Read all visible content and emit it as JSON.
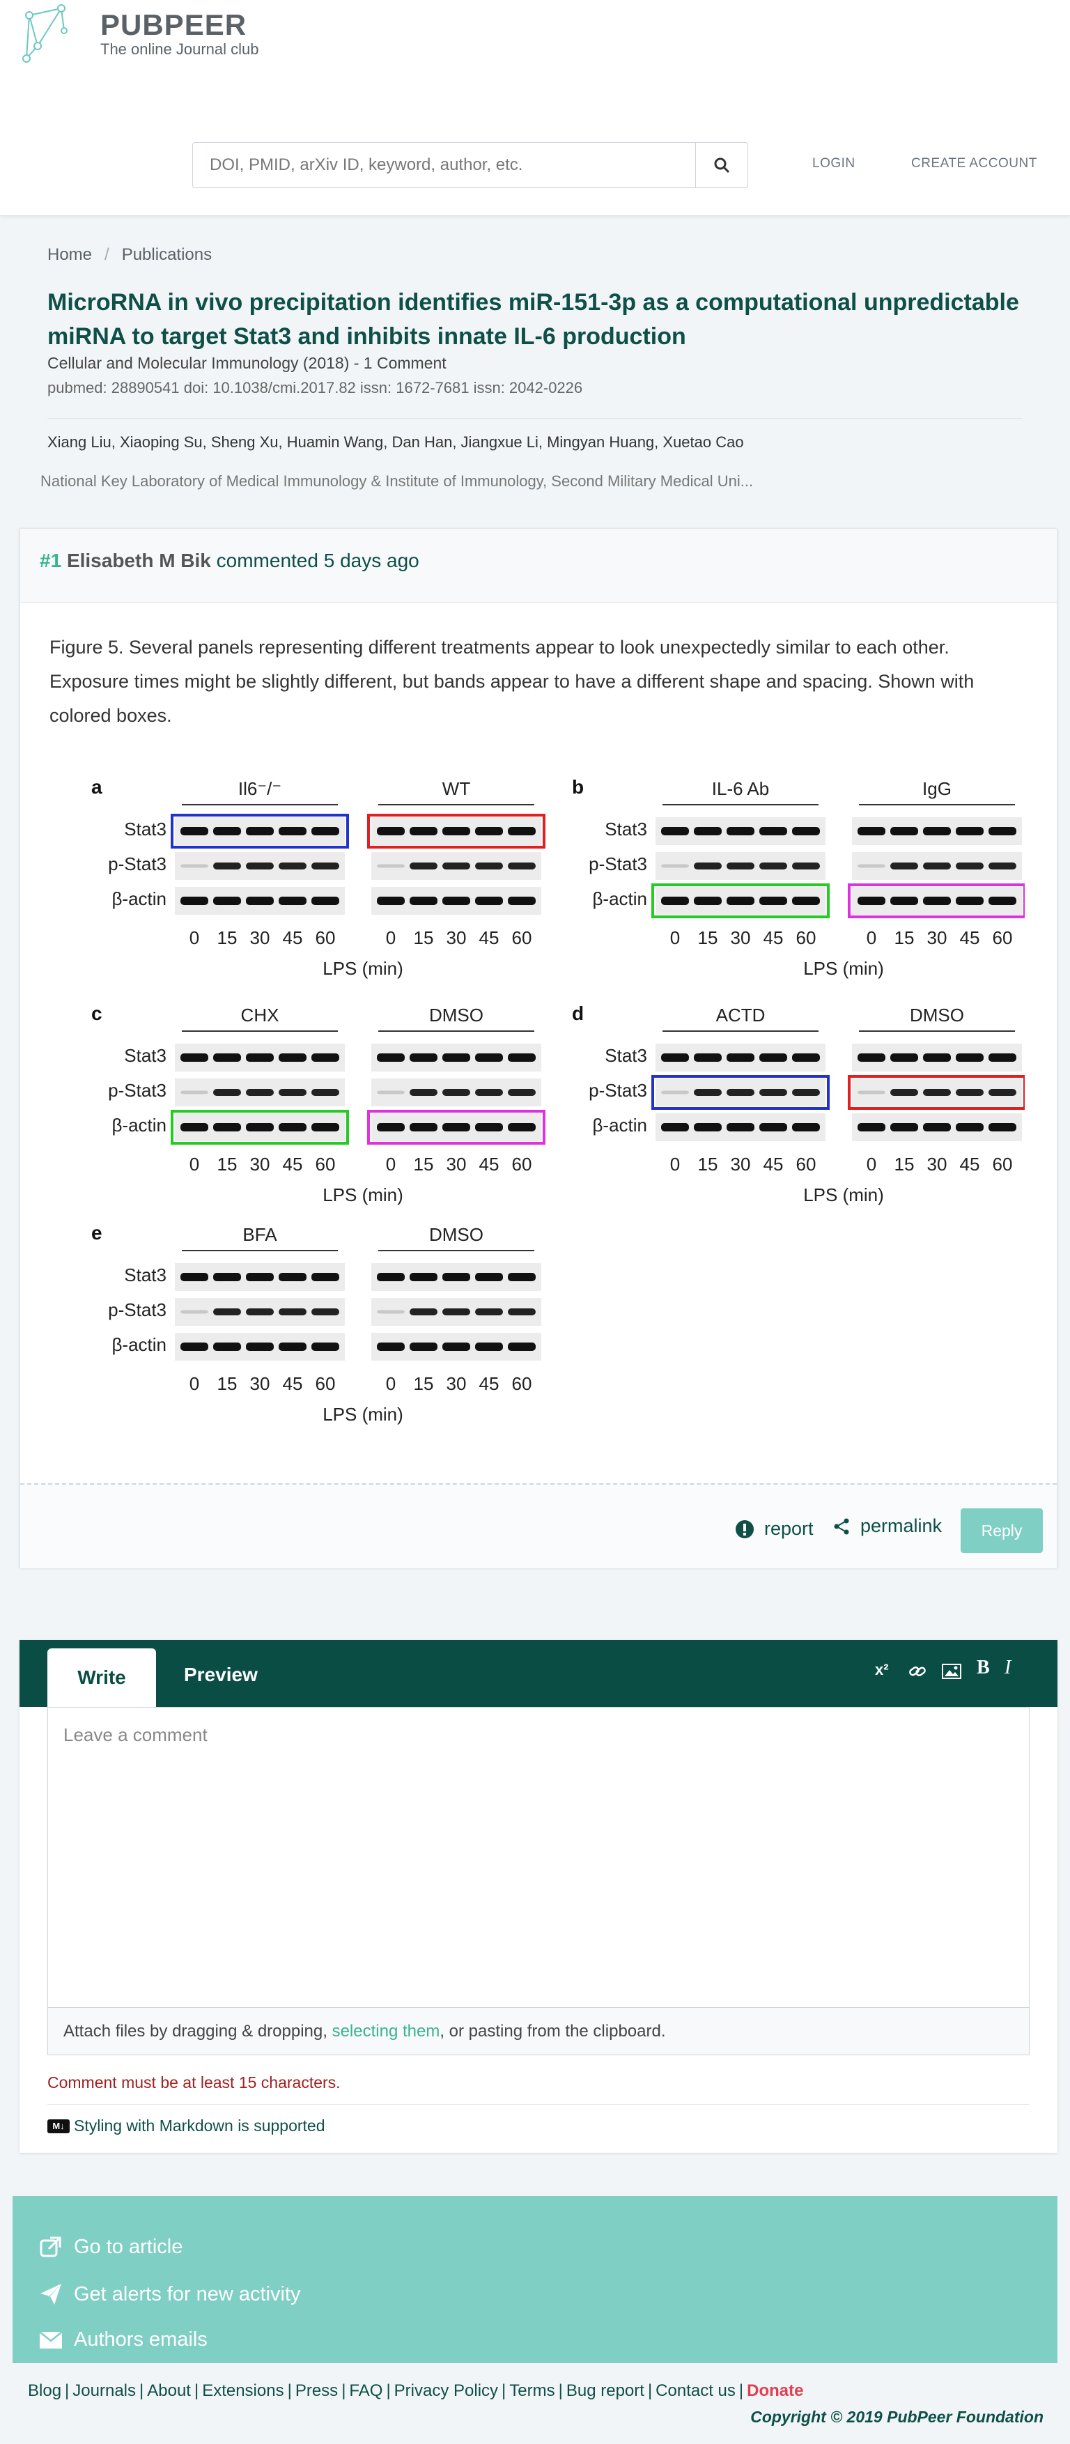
{
  "header": {
    "logo_text": "PUBPEER",
    "tagline": "The online Journal club",
    "search_placeholder": "DOI, PMID, arXiv ID, keyword, author, etc.",
    "login": "LOGIN",
    "create_account": "CREATE ACCOUNT"
  },
  "breadcrumb": [
    "Home",
    "Publications"
  ],
  "article": {
    "title": "MicroRNA in vivo precipitation identifies miR-151-3p as a computational unpredictable miRNA to target Stat3 and inhibits innate IL-6 production",
    "journal": "Cellular and Molecular Immunology (2018) - 1 Comment",
    "ids": "pubmed: 28890541  doi: 10.1038/cmi.2017.82  issn: 1672-7681  issn: 2042-0226",
    "authors": "Xiang Liu, Xiaoping Su, Sheng Xu, Huamin Wang, Dan Han, Jiangxue Li, Mingyan Huang, Xuetao Cao",
    "affiliation": "National Key Laboratory of Medical Immunology & Institute of Immunology, Second Military Medical Uni..."
  },
  "comment": {
    "number": "#1",
    "author": "Elisabeth M Bik",
    "when": "commented 5 days ago",
    "body": "Figure 5. Several panels representing different treatments appear to look unexpectedly similar to each other. Exposure times might be slightly different, but bands appear to have a different shape and spacing. Shown with colored boxes.",
    "report": "report",
    "permalink": "permalink",
    "reply": "Reply"
  },
  "figure": {
    "row_labels": [
      "Stat3",
      "p-Stat3",
      "β-actin"
    ],
    "timepoints": [
      "0",
      "15",
      "30",
      "45",
      "60"
    ],
    "axis_label": "LPS (min)",
    "panels": [
      {
        "letter": "a",
        "groups": [
          "Il6⁻/⁻",
          "WT"
        ]
      },
      {
        "letter": "b",
        "groups": [
          "IL-6 Ab",
          "IgG"
        ]
      },
      {
        "letter": "c",
        "groups": [
          "CHX",
          "DMSO"
        ]
      },
      {
        "letter": "d",
        "groups": [
          "ACTD",
          "DMSO"
        ]
      },
      {
        "letter": "e",
        "groups": [
          "BFA",
          "DMSO"
        ]
      }
    ],
    "box_colors": {
      "blue": "#2233cc",
      "red": "#e02020",
      "green": "#22cc22",
      "magenta": "#e030e0"
    }
  },
  "editor": {
    "tab_write": "Write",
    "tab_preview": "Preview",
    "placeholder": "Leave a comment",
    "attach_prefix": "Attach files by dragging & dropping, ",
    "attach_link": "selecting them",
    "attach_suffix": ", or pasting from the clipboard.",
    "validation": "Comment must be at least 15 characters.",
    "markdown_note": "Styling with Markdown is supported",
    "markdown_badge": "M↓"
  },
  "actions": [
    "Go to article",
    "Get alerts for new activity",
    "Authors emails"
  ],
  "footer": {
    "links": [
      "Blog",
      "Journals",
      "About",
      "Extensions",
      "Press",
      "FAQ",
      "Privacy Policy",
      "Terms",
      "Bug report",
      "Contact us"
    ],
    "donate": "Donate",
    "copyright": "Copyright © 2019 PubPeer Foundation"
  },
  "colors": {
    "brand_dark": "#0a4d45",
    "brand_teal": "#7fcfc4",
    "accent_green": "#38b58a"
  }
}
